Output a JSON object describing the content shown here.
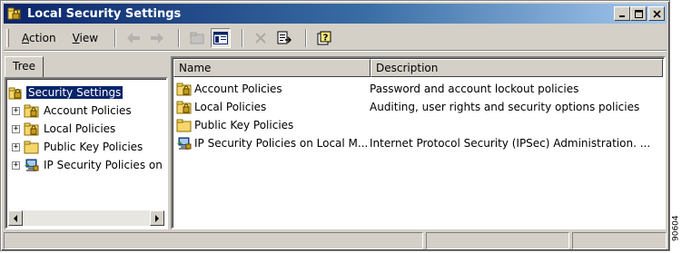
{
  "window": {
    "title": "Local Security Settings",
    "buttons": {
      "minimize": "_",
      "maximize": "□",
      "close": "×"
    }
  },
  "toolbar": {
    "menus": [
      {
        "label": "Action",
        "accel": "A",
        "rest": "ction"
      },
      {
        "label": "View",
        "accel": "V",
        "rest": "iew"
      }
    ],
    "tools": [
      "back-arrow-icon",
      "forward-arrow-icon",
      "up-folder-icon",
      "show-hide-tree-icon",
      "delete-icon",
      "export-list-icon",
      "help-icon"
    ]
  },
  "tree": {
    "tab_label": "Tree",
    "items": [
      {
        "label": "Security Settings",
        "selected": true,
        "icon": "security-settings-icon"
      },
      {
        "label": "Account Policies",
        "icon": "policy-folder-icon"
      },
      {
        "label": "Local Policies",
        "icon": "policy-folder-icon"
      },
      {
        "label": "Public Key Policies",
        "icon": "folder-icon"
      },
      {
        "label": "IP Security Policies on",
        "icon": "ip-security-icon"
      }
    ]
  },
  "list": {
    "columns": [
      "Name",
      "Description"
    ],
    "rows": [
      {
        "name": "Account Policies",
        "description": "Password and account lockout policies",
        "icon": "policy-folder-icon"
      },
      {
        "name": "Local Policies",
        "description": "Auditing, user rights and security options policies",
        "icon": "policy-folder-icon"
      },
      {
        "name": "Public Key Policies",
        "description": "",
        "icon": "folder-icon"
      },
      {
        "name": "IP Security Policies on Local M...",
        "description": "Internet Protocol Security (IPSec) Administration. ...",
        "icon": "ip-security-icon"
      }
    ]
  },
  "side_code": "90604",
  "colors": {
    "titlebar_start": "#0a246a",
    "titlebar_end": "#a6caf0",
    "face": "#d4d0c8",
    "selection": "#0a246a",
    "folder": "#f5d66b"
  }
}
